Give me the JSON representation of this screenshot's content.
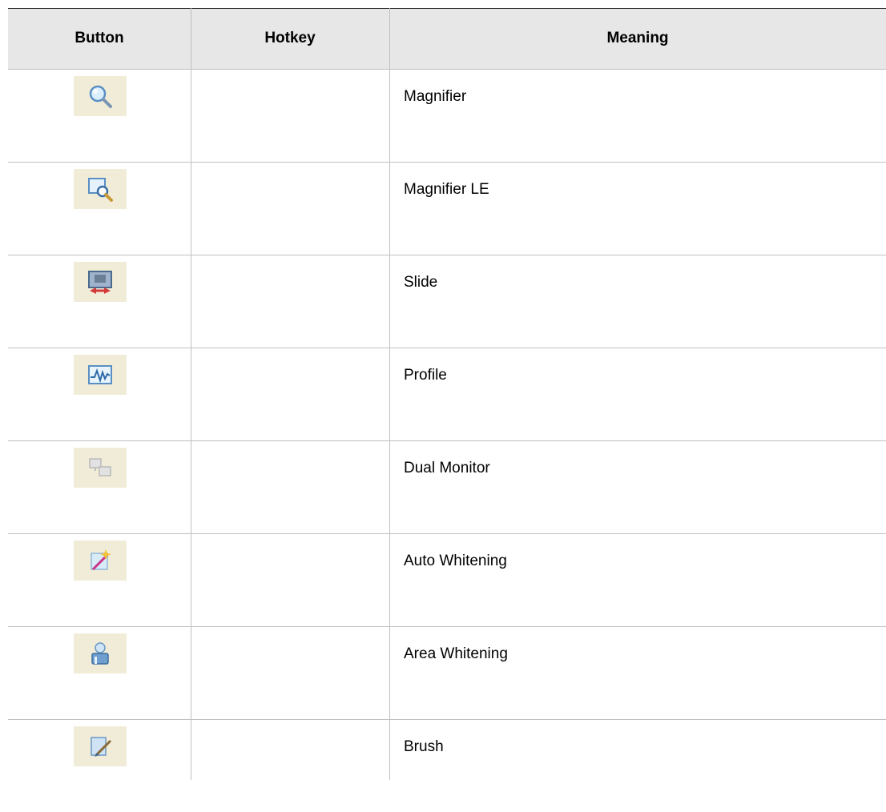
{
  "table": {
    "headers": {
      "button": "Button",
      "hotkey": "Hotkey",
      "meaning": "Meaning"
    },
    "rows": [
      {
        "icon": "magnifier-icon",
        "hotkey": "",
        "meaning": "Magnifier"
      },
      {
        "icon": "magnifier-le-icon",
        "hotkey": "",
        "meaning": "Magnifier LE"
      },
      {
        "icon": "slide-icon",
        "hotkey": "",
        "meaning": "Slide"
      },
      {
        "icon": "profile-icon",
        "hotkey": "",
        "meaning": "Profile"
      },
      {
        "icon": "dual-monitor-icon",
        "hotkey": "",
        "meaning": "Dual Monitor"
      },
      {
        "icon": "auto-whitening-icon",
        "hotkey": "",
        "meaning": "Auto Whitening"
      },
      {
        "icon": "area-whitening-icon",
        "hotkey": "",
        "meaning": "Area Whitening"
      },
      {
        "icon": "brush-icon",
        "hotkey": "",
        "meaning": "Brush"
      }
    ]
  }
}
